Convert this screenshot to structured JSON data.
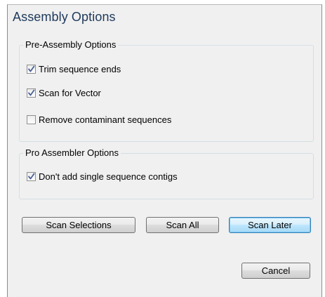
{
  "dialog": {
    "title": "Assembly Options"
  },
  "pre_assembly": {
    "label": "Pre-Assembly Options",
    "options": [
      {
        "label": "Trim sequence ends",
        "checked": true
      },
      {
        "label": "Scan for Vector",
        "checked": true
      },
      {
        "label": "Remove contaminant sequences",
        "checked": false
      }
    ]
  },
  "pro_assembler": {
    "label": "Pro Assembler Options",
    "options": [
      {
        "label": "Don't add single sequence contigs",
        "checked": true
      }
    ]
  },
  "buttons": {
    "scan_selections": "Scan Selections",
    "scan_all": "Scan All",
    "scan_later": "Scan Later",
    "cancel": "Cancel"
  },
  "colors": {
    "title_text": "#1e395b",
    "dialog_bg": "#f0f0f0",
    "check_mark": "#4a5f97"
  }
}
